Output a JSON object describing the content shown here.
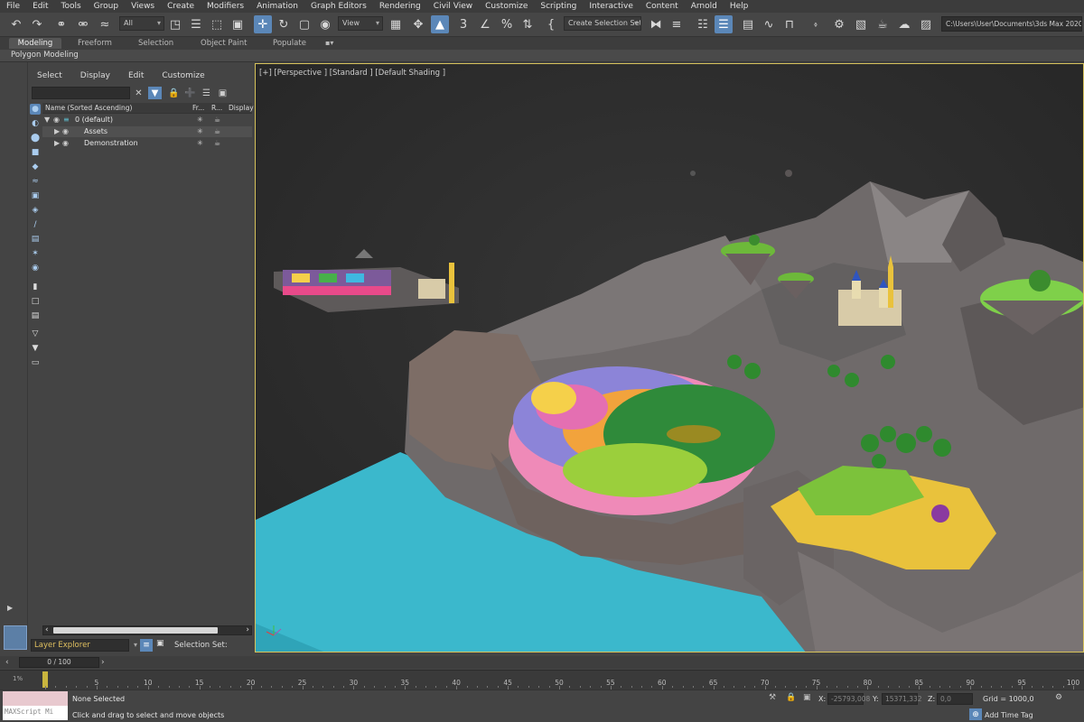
{
  "menu": [
    "File",
    "Edit",
    "Tools",
    "Group",
    "Views",
    "Create",
    "Modifiers",
    "Animation",
    "Graph Editors",
    "Rendering",
    "Civil View",
    "Customize",
    "Scripting",
    "Interactive",
    "Content",
    "Arnold",
    "Help"
  ],
  "toolbar": {
    "filter_value": "All",
    "view_value": "View",
    "selection_set_value": "Create Selection Set",
    "project_path": "C:\\Users\\User\\Documents\\3ds Max 2020"
  },
  "ribbon": {
    "tabs": [
      "Modeling",
      "Freeform",
      "Selection",
      "Object Paint",
      "Populate"
    ],
    "sub_label": "Polygon Modeling"
  },
  "explorer": {
    "menu": [
      "Select",
      "Display",
      "Edit",
      "Customize"
    ],
    "columns": {
      "name": "Name (Sorted Ascending)",
      "frozen": "Fr...",
      "render": "R...",
      "display": "Display"
    },
    "rows": [
      {
        "label": "0 (default)"
      },
      {
        "label": "Assets"
      },
      {
        "label": "Demonstration"
      }
    ],
    "layer_dropdown": "Layer Explorer",
    "selection_set_label": "Selection Set:"
  },
  "viewport": {
    "label": "[+] [Perspective ] [Standard ] [Default Shading ]"
  },
  "timeline": {
    "slider_text": "0 / 100",
    "ticks": [
      5,
      10,
      15,
      20,
      25,
      30,
      35,
      40,
      45,
      50,
      55,
      60,
      65,
      70,
      75,
      80,
      85,
      90,
      95,
      100
    ]
  },
  "status": {
    "maxscript": "MAXScript Mi",
    "selection": "None Selected",
    "hint": "Click and drag to select and move objects",
    "x_label": "X:",
    "x_value": "-25793,008",
    "y_label": "Y:",
    "y_value": "15371,332",
    "z_label": "Z:",
    "z_value": "0,0",
    "grid": "Grid = 1000,0",
    "add_time_tag": "Add Time Tag"
  },
  "colors": {
    "accent": "#5b87b8",
    "viewport_border": "#d6c25a",
    "water": "#3bb8cc"
  }
}
